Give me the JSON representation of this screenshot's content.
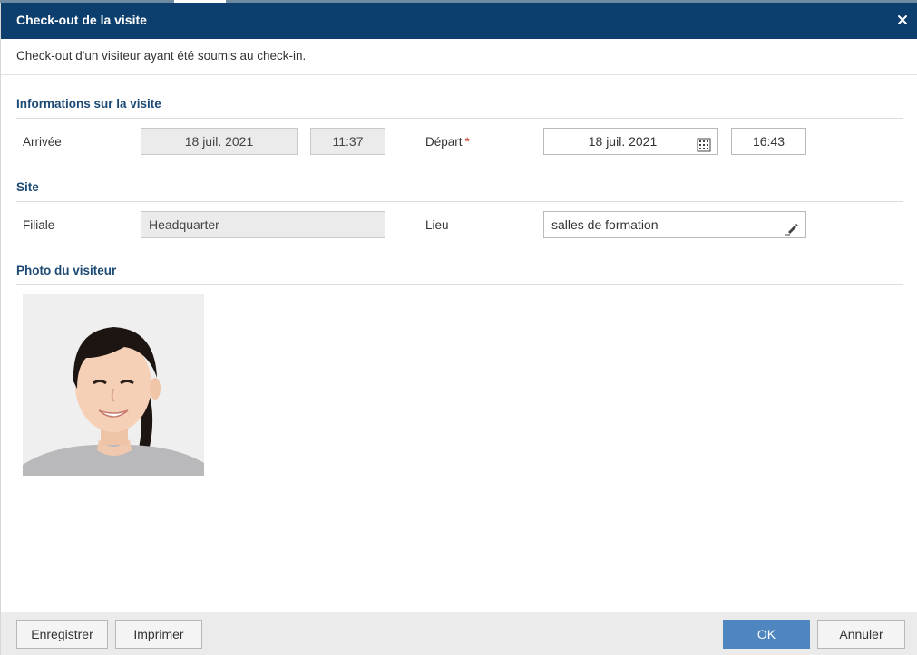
{
  "dialog": {
    "title": "Check-out de la visite",
    "subtitle": "Check-out d'un visiteur ayant été soumis au check-in.",
    "close_icon": "close-icon"
  },
  "visit_info": {
    "heading": "Informations sur la visite",
    "arrival_label": "Arrivée",
    "arrival_date": "18 juil. 2021",
    "arrival_time": "11:37",
    "departure_label": "Départ",
    "required_mark": "*",
    "departure_date": "18 juil. 2021",
    "departure_time": "16:43",
    "calendar_icon": "calendar-icon"
  },
  "site": {
    "heading": "Site",
    "branch_label": "Filiale",
    "branch_value": "Headquarter",
    "location_label": "Lieu",
    "location_value": "salles de formation",
    "edit_icon": "pencil-icon"
  },
  "photo": {
    "heading": "Photo du visiteur"
  },
  "footer": {
    "save_label": "Enregistrer",
    "print_label": "Imprimer",
    "ok_label": "OK",
    "cancel_label": "Annuler"
  },
  "colors": {
    "titlebar": "#0d3f6e",
    "section_heading": "#1d4a74",
    "primary_button": "#4f86c0",
    "required": "#c0392b"
  }
}
